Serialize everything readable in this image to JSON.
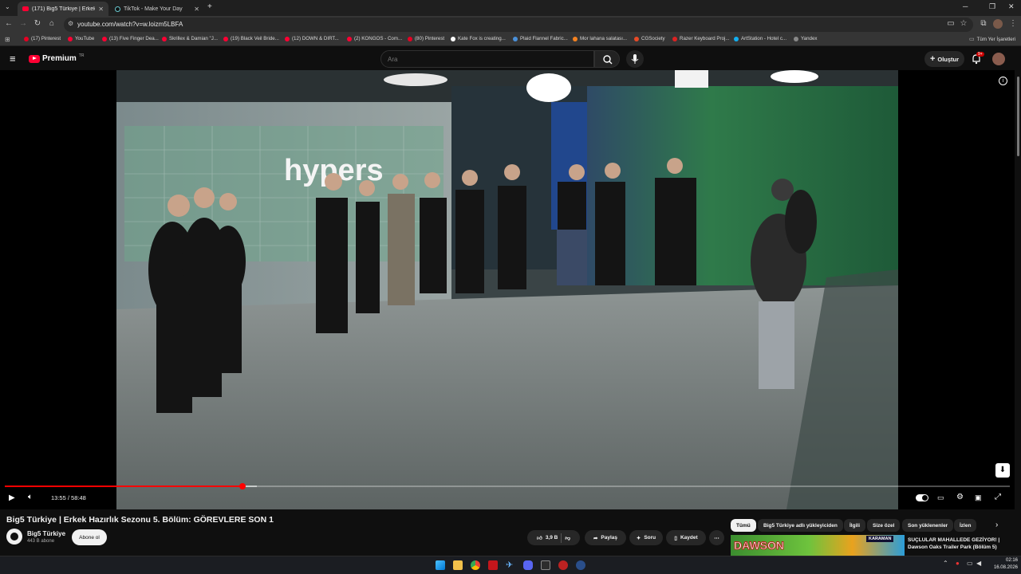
{
  "browser": {
    "tabs": [
      {
        "label": "(171) Big5 Türkiye | Erkek Hazırl",
        "active": true
      },
      {
        "label": "TikTok - Make Your Day",
        "active": false
      }
    ],
    "url": "youtube.com/watch?v=w.loizm5LBFA",
    "bookmarks": [
      {
        "label": "(17) Pinterest",
        "color": "#e60023"
      },
      {
        "label": "YouTube",
        "color": "#ff0033"
      },
      {
        "label": "(13) Five Finger Dea...",
        "color": "#ff0033"
      },
      {
        "label": "Skrillex & Damian \"J...",
        "color": "#ff0033"
      },
      {
        "label": "(19) Black Veil Bride...",
        "color": "#ff0033"
      },
      {
        "label": "(12) DOWN & DIRT...",
        "color": "#ff0033"
      },
      {
        "label": "(2) KONGOS - Com...",
        "color": "#ff0033"
      },
      {
        "label": "(80) Pinterest",
        "color": "#e60023"
      },
      {
        "label": "Kate Fox is creating...",
        "color": "#ffffff"
      },
      {
        "label": "Plaid Flannel Fabric...",
        "color": "#4a90d9"
      },
      {
        "label": "Mor lahana salatası...",
        "color": "#f58220"
      },
      {
        "label": "CGSociety",
        "color": "#e84a27"
      },
      {
        "label": "Razer Keyboard Proj...",
        "color": "#d22"
      },
      {
        "label": "ArtStation - Hotel c...",
        "color": "#13aff0"
      },
      {
        "label": "Yandex",
        "color": "#888888"
      }
    ],
    "other_bookmarks": "Tüm Yer İşaretleri"
  },
  "youtube": {
    "logo": "Premium",
    "logo_sup": "TR",
    "search_placeholder": "Ara",
    "create_label": "Oluştur",
    "notif_badge": "9+"
  },
  "player": {
    "current_time": "13:55",
    "duration": "58:48",
    "time_display": "13:55 / 58:48",
    "progress_fraction": 0.2367,
    "buffered_fraction": 0.251,
    "sign_text": "hypers"
  },
  "video": {
    "title": "Big5 Türkiye | Erkek Hazırlık Sezonu 5. Bölüm: GÖREVLERE SON 1",
    "channel": "Big5 Türkiye",
    "subscribers": "443 B abone",
    "subscribe_label": "Abone ol",
    "likes": "3,9 B",
    "share_label": "Paylaş",
    "ask_label": "Soru",
    "save_label": "Kaydet"
  },
  "chips": [
    {
      "label": "Tümü",
      "active": true
    },
    {
      "label": "Big5 Türkiye adlı yükleyiciden",
      "active": false
    },
    {
      "label": "İlgili",
      "active": false
    },
    {
      "label": "Size özel",
      "active": false
    },
    {
      "label": "Son yüklenenler",
      "active": false
    },
    {
      "label": "İzlen",
      "active": false
    }
  ],
  "recommendation": {
    "title": "SUÇLULAR MAHALLEDE GEZİYOR! | Dawson Oaks Trailer Park (Bölüm 5)",
    "thumb_text": "DAWSON",
    "thumb_badge": "KARAMAN"
  },
  "taskbar": {
    "time": "02:16",
    "date": "16.08.2026"
  }
}
